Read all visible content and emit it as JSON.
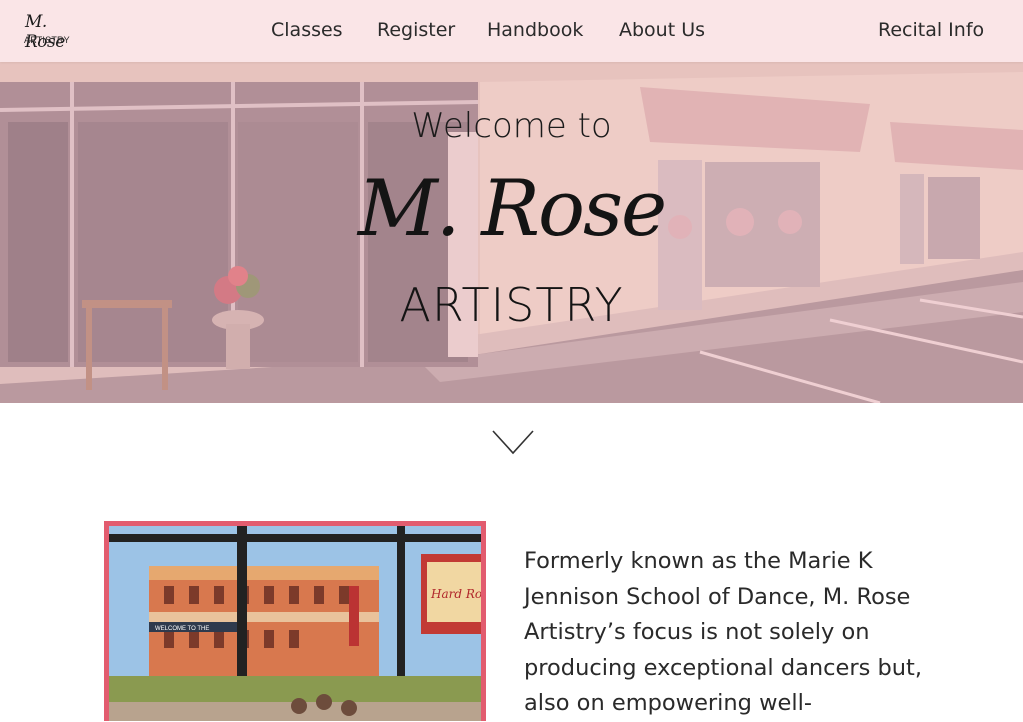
{
  "header": {
    "logo_script": "M. Rose",
    "logo_sub": "ARTISTRY",
    "nav": {
      "classes": "Classes",
      "register": "Register",
      "handbook": "Handbook",
      "about": "About Us",
      "recital": "Recital Info"
    }
  },
  "hero": {
    "welcome": "Welcome to",
    "script_name": "M. Rose",
    "artistry": "ARTISTRY"
  },
  "about": {
    "text": "Formerly known as the Marie K Jennison School of Dance, M. Rose Artistry’s focus is not solely on producing exceptional dancers but, also on empowering well-"
  },
  "photo": {
    "sign_text": "Hard Rock CAFE",
    "banner_text": "WELCOME TO THE"
  },
  "colors": {
    "header_bg": "#fae5e7",
    "hero_tint": "#eeaab2",
    "photo_border": "#e25c6f"
  }
}
